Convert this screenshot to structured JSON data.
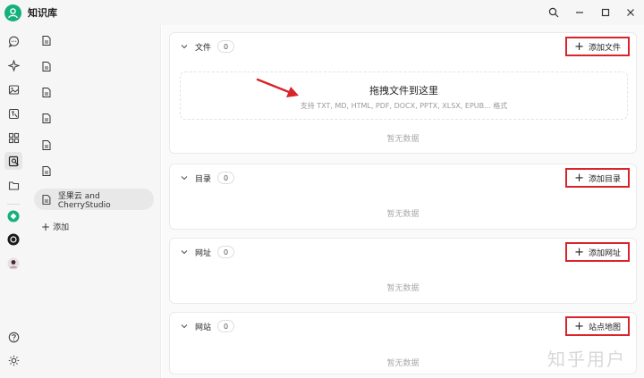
{
  "app": {
    "title": "知识库"
  },
  "rail": {
    "icons": [
      "chat-icon",
      "sparkle-icon",
      "image-icon",
      "translate-icon",
      "apps-grid-icon",
      "knowledge-icon",
      "folder-icon",
      "help-icon",
      "theme-sun-icon"
    ]
  },
  "sidebar": {
    "items": [
      {
        "label": ""
      },
      {
        "label": ""
      },
      {
        "label": ""
      },
      {
        "label": ""
      },
      {
        "label": ""
      },
      {
        "label": ""
      },
      {
        "label": "坚果云 and CherryStudio"
      }
    ],
    "add_label": "添加"
  },
  "sections": {
    "files": {
      "title": "文件",
      "count": "0",
      "add_label": "添加文件",
      "dropzone_title": "拖拽文件到这里",
      "dropzone_sub": "支持 TXT, MD, HTML, PDF, DOCX, PPTX, XLSX, EPUB... 格式",
      "empty": "暂无数据"
    },
    "directory": {
      "title": "目录",
      "count": "0",
      "add_label": "添加目录",
      "empty": "暂无数据"
    },
    "url": {
      "title": "网址",
      "count": "0",
      "add_label": "添加网址",
      "empty": "暂无数据"
    },
    "site": {
      "title": "网站",
      "count": "0",
      "add_label": "站点地图",
      "empty": "暂无数据"
    }
  },
  "watermark": "知乎用户",
  "colors": {
    "accent": "#14b17a",
    "highlight_border": "#d8242b"
  }
}
